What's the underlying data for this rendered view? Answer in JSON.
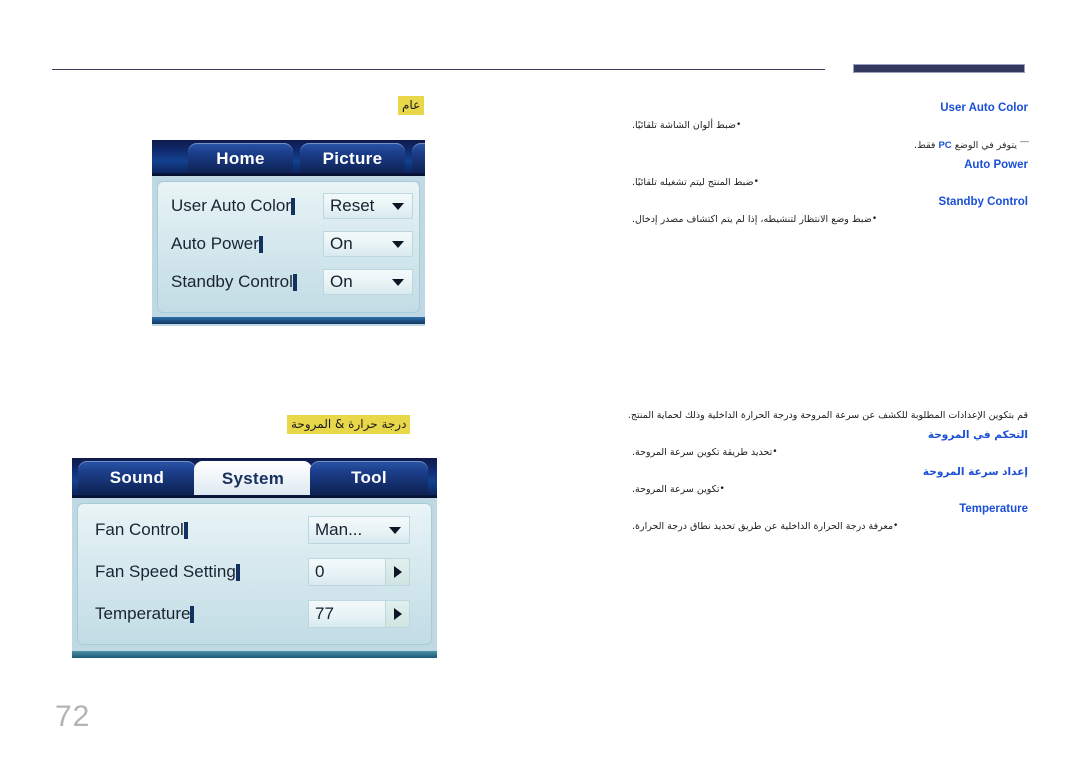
{
  "page": {
    "number": "72",
    "accent_heading_color": "#1a4fd6",
    "highlight_color": "#e8d849",
    "rule_color": "#32385e"
  },
  "sections": {
    "general": {
      "heading": "عام"
    },
    "fan": {
      "heading": "درجة حرارة & المروحة"
    }
  },
  "osd_general": {
    "tabs": [
      {
        "label": "Home",
        "active": false
      },
      {
        "label": "Picture",
        "active": false
      },
      {
        "label": "",
        "active": false
      }
    ],
    "rows": [
      {
        "label": "User Auto Color",
        "value": "Reset",
        "control": "dropdown"
      },
      {
        "label": "Auto Power",
        "value": "On",
        "control": "dropdown"
      },
      {
        "label": "Standby Control",
        "value": "On",
        "control": "dropdown"
      }
    ]
  },
  "osd_fan": {
    "tabs": [
      {
        "label": "Sound",
        "active": false
      },
      {
        "label": "System",
        "active": true
      },
      {
        "label": "Tool",
        "active": false
      }
    ],
    "rows": [
      {
        "label": "Fan Control",
        "value": "Man...",
        "control": "dropdown"
      },
      {
        "label": "Fan Speed Setting",
        "value": "0",
        "control": "stepper"
      },
      {
        "label": "Temperature",
        "value": "77",
        "control": "stepper"
      }
    ]
  },
  "desc_general": {
    "items": [
      {
        "heading": "User Auto Color",
        "heading_lang": "en",
        "bullet": "ضبط ألوان الشاشة تلقائيًا.",
        "note_prefix": "يتوفر في الوضع",
        "note_bold": "PC",
        "note_suffix": "فقط."
      },
      {
        "heading": "Auto Power",
        "heading_lang": "en",
        "bullet": "ضبط المنتج ليتم تشغيله تلقائيًا."
      },
      {
        "heading": "Standby Control",
        "heading_lang": "en",
        "bullet": "ضبط وضع الانتظار لتنشيطه، إذا لم يتم اكتشاف مصدر إدخال."
      }
    ]
  },
  "desc_fan": {
    "intro": "قم بتكوين الإعدادات المطلوبة للكشف عن سرعة المروحة ودرجة الحرارة الداخلية وذلك لحماية المنتج.",
    "items": [
      {
        "heading": "التحكم في المروحة",
        "heading_lang": "ar",
        "bullet": "تحديد طريقة تكوين سرعة المروحة."
      },
      {
        "heading": "إعداد سرعة المروحة",
        "heading_lang": "ar",
        "bullet": "تكوين سرعة المروحة."
      },
      {
        "heading": "Temperature",
        "heading_lang": "en",
        "bullet": "معرفة درجة الحرارة الداخلية عن طريق تحديد نطاق درجة الحرارة."
      }
    ]
  }
}
